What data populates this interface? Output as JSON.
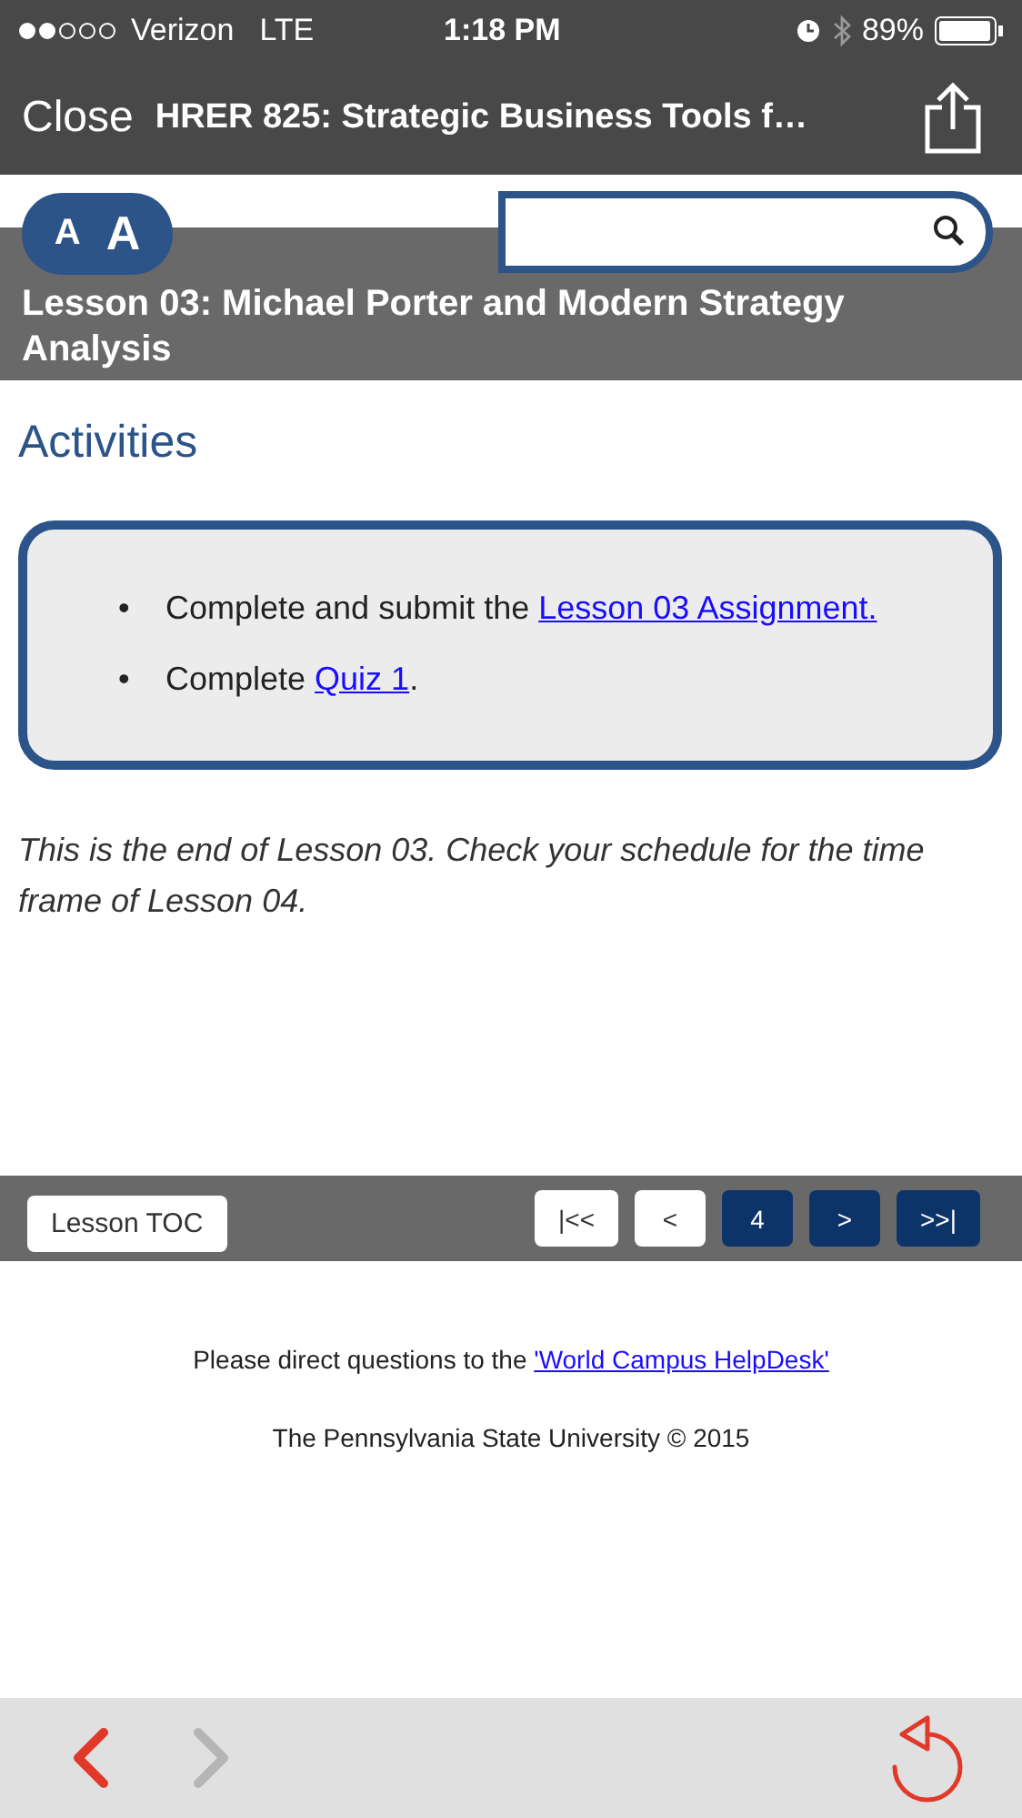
{
  "status_bar": {
    "carrier": "Verizon",
    "network": "LTE",
    "time": "1:18 PM",
    "battery": "89%"
  },
  "nav_bar": {
    "close": "Close",
    "title": "HRER 825: Strategic Business Tools f…"
  },
  "font_size_buttons": [
    "A",
    "A"
  ],
  "lesson_title": "Lesson 03: Michael Porter and Modern Strategy Analysis",
  "section_heading": "Activities",
  "activities": [
    {
      "bullet": "•",
      "before": "Complete and submit the ",
      "link": "Lesson 03 Assignment."
    },
    {
      "bullet": "•",
      "before": "Complete ",
      "link": "Quiz 1",
      "after": "."
    }
  ],
  "closing_note": "This is the end of Lesson 03. Check your schedule for the time frame of Lesson 04.",
  "lesson_toc": "Lesson TOC",
  "pagination": [
    {
      "label": "|<<",
      "disabled": true
    },
    {
      "label": "<",
      "disabled": true
    },
    {
      "label": "4",
      "disabled": false
    },
    {
      "label": ">",
      "disabled": false
    },
    {
      "label": ">>|",
      "disabled": false
    }
  ],
  "footer": {
    "before": "Please direct questions to the ",
    "link": "'World Campus HelpDesk'",
    "copyright": "The Pennsylvania State University © 2015"
  },
  "toolbar": {
    "back_disabled": false,
    "forward_disabled": true
  }
}
